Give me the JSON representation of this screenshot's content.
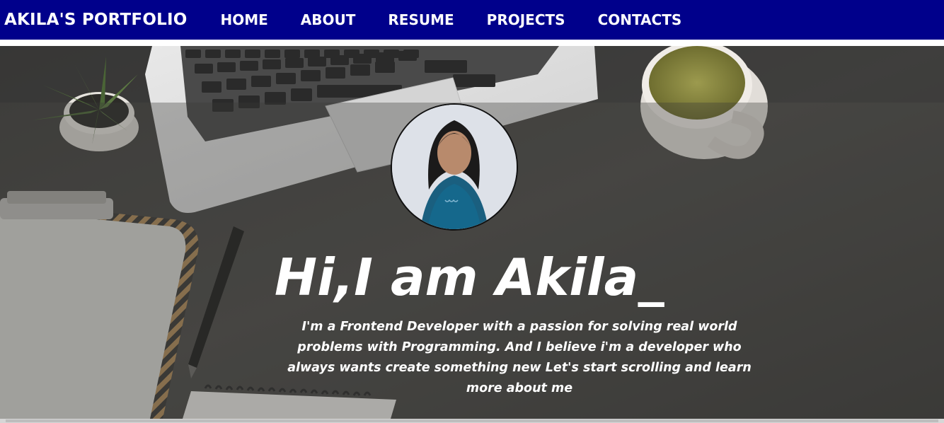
{
  "navbar": {
    "brand": "AKILA'S PORTFOLIO",
    "links": [
      "HOME",
      "ABOUT",
      "RESUME",
      "PROJECTS",
      "CONTACTS"
    ],
    "background_color": "#00008b"
  },
  "hero": {
    "headline": "Hi,I am Akila_",
    "intro": "I'm a Frontend Developer with a passion for solving real world problems with Programming. And I believe i'm a developer who always wants create something new Let's start scrolling and learn more about me",
    "background_image": "desk-with-laptop-coffee-plant-clipboard"
  },
  "profile": {
    "image": "profile-photo-woman-in-blue-top"
  }
}
